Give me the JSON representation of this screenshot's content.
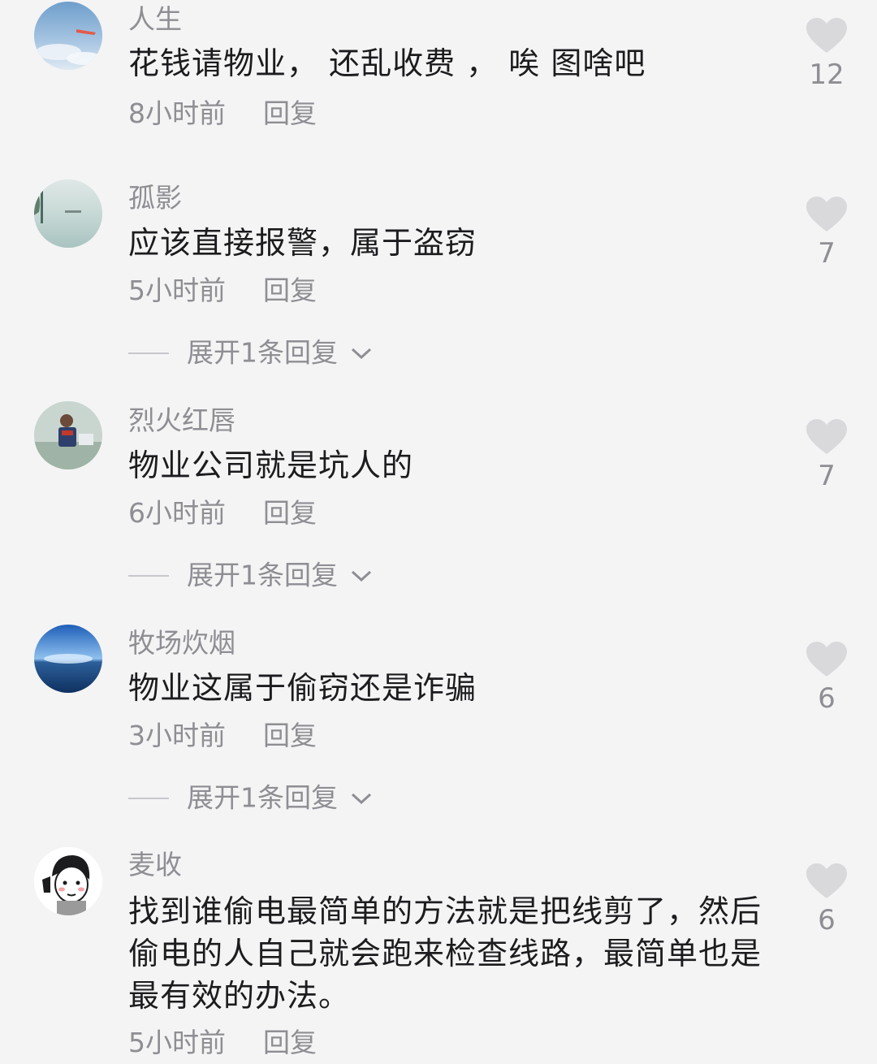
{
  "comments": [
    {
      "user": "人生",
      "text": "花钱请物业， 还乱收费 ， 唉 图啥吧",
      "time": "8小时前",
      "reply": "回复",
      "likes": "12",
      "avatar": "sky-plane-avatar"
    },
    {
      "user": "孤影",
      "text": "应该直接报警，属于盗窃",
      "time": "5小时前",
      "reply": "回复",
      "likes": "7",
      "expand": "展开1条回复",
      "avatar": "lake-avatar"
    },
    {
      "user": "烈火红唇",
      "text": "物业公司就是坑人的",
      "time": "6小时前",
      "reply": "回复",
      "likes": "7",
      "expand": "展开1条回复",
      "avatar": "person-outdoor-avatar"
    },
    {
      "user": "牧场炊烟",
      "text": "物业这属于偷窃还是诈骗",
      "time": "3小时前",
      "reply": "回复",
      "likes": "6",
      "expand": "展开1条回复",
      "avatar": "ocean-avatar"
    },
    {
      "user": "麦收",
      "text": "找到谁偷电最简单的方法就是把线剪了，然后偷电的人自己就会跑来检查线路，最简单也是最有效的办法。",
      "time": "5小时前",
      "reply": "回复",
      "likes": "6",
      "avatar": "cartoon-avatar"
    }
  ],
  "colors": {
    "heart": "#d9d9dc",
    "text": "#1c1c1e",
    "muted": "#8e8e93"
  }
}
